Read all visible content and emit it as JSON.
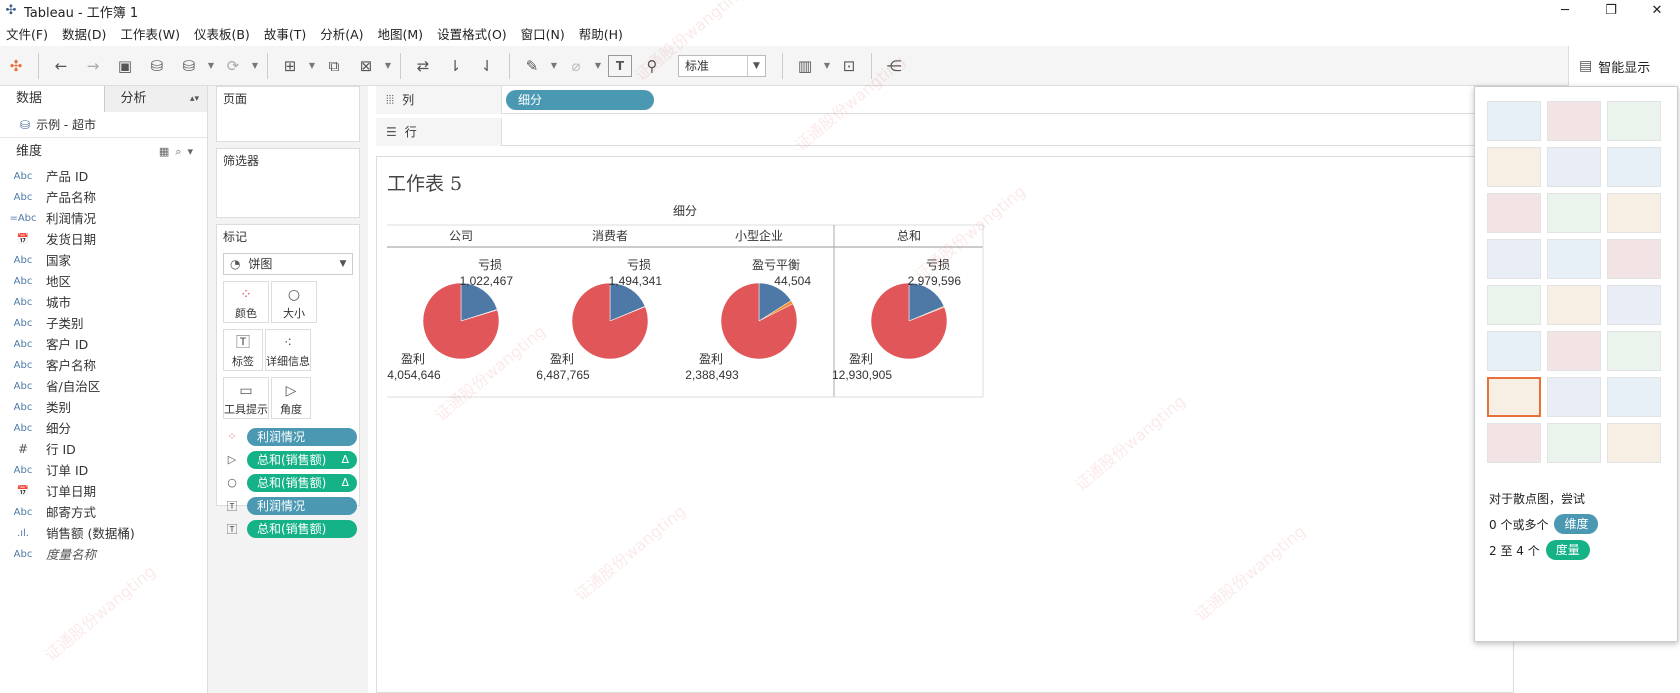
{
  "window": {
    "title": "Tableau - 工作簿 1",
    "minimize": "─",
    "maximize": "❐",
    "close": "✕"
  },
  "menu": [
    "文件(F)",
    "数据(D)",
    "工作表(W)",
    "仪表板(B)",
    "故事(T)",
    "分析(A)",
    "地图(M)",
    "设置格式(O)",
    "窗口(N)",
    "帮助(H)"
  ],
  "toolbar": {
    "fit_select": "标准",
    "smart_show_label": "智能显示"
  },
  "data_pane": {
    "tab_data": "数据",
    "tab_analysis": "分析",
    "source": "示例 - 超市",
    "dimensions_header": "维度",
    "fields": [
      {
        "type": "Abc",
        "name": "产品 ID"
      },
      {
        "type": "Abc",
        "name": "产品名称"
      },
      {
        "type": "=Abc",
        "name": "利润情况"
      },
      {
        "type": "📅",
        "name": "发货日期"
      },
      {
        "type": "Abc",
        "name": "国家"
      },
      {
        "type": "Abc",
        "name": "地区"
      },
      {
        "type": "Abc",
        "name": "城市"
      },
      {
        "type": "Abc",
        "name": "子类别"
      },
      {
        "type": "Abc",
        "name": "客户 ID"
      },
      {
        "type": "Abc",
        "name": "客户名称"
      },
      {
        "type": "Abc",
        "name": "省/自治区"
      },
      {
        "type": "Abc",
        "name": "类别"
      },
      {
        "type": "Abc",
        "name": "细分"
      },
      {
        "type": "#",
        "name": "行 ID"
      },
      {
        "type": "Abc",
        "name": "订单 ID"
      },
      {
        "type": "📅",
        "name": "订单日期"
      },
      {
        "type": "Abc",
        "name": "邮寄方式"
      },
      {
        "type": ".ıl.",
        "name": "销售额 (数据桶)"
      },
      {
        "type": "Abc",
        "name": "度量名称"
      }
    ]
  },
  "cards": {
    "pages": "页面",
    "filters": "筛选器",
    "marks": "标记",
    "mark_type": "饼图",
    "mark_buttons": [
      "颜色",
      "大小",
      "标签",
      "详细信息",
      "工具提示",
      "角度"
    ],
    "mark_pills": [
      {
        "label": "利润情况",
        "kind": "blue",
        "delta": ""
      },
      {
        "label": "总和(销售额)",
        "kind": "green",
        "delta": "Δ"
      },
      {
        "label": "总和(销售额)",
        "kind": "green",
        "delta": "Δ"
      },
      {
        "label": "利润情况",
        "kind": "blue",
        "delta": ""
      },
      {
        "label": "总和(销售额)",
        "kind": "green",
        "delta": ""
      }
    ]
  },
  "shelves": {
    "columns_label": "列",
    "rows_label": "行",
    "columns_pill": "细分"
  },
  "sheet": {
    "title": "工作表 5",
    "header": "细分"
  },
  "chart_data": {
    "type": "pie",
    "columns": [
      "公司",
      "消费者",
      "小型企业",
      "总和"
    ],
    "slices": [
      {
        "category": "公司",
        "亏损": 1022467,
        "盈亏平衡": 12000,
        "盈利": 4054646
      },
      {
        "category": "消费者",
        "亏损": 1494341,
        "盈亏平衡": 15000,
        "盈利": 6487765
      },
      {
        "category": "小型企业",
        "亏损": 462788,
        "盈亏平衡": 44504,
        "盈利": 2388493
      },
      {
        "category": "总和",
        "亏损": 2979596,
        "盈亏平衡": 71504,
        "盈利": 12930905
      }
    ],
    "labels": [
      {
        "top_name": "亏损",
        "top_value": "1,022,467",
        "bottom_name": "盈利",
        "bottom_value": "4,054,646"
      },
      {
        "top_name": "亏损",
        "top_value": "1,494,341",
        "bottom_name": "盈利",
        "bottom_value": "6,487,765"
      },
      {
        "top_name": "盈亏平衡",
        "top_value": "44,504",
        "bottom_name": "盈利",
        "bottom_value": "2,388,493"
      },
      {
        "top_name": "亏损",
        "top_value": "2,979,596",
        "bottom_name": "盈利",
        "bottom_value": "12,930,905"
      }
    ],
    "colors": {
      "亏损": "#4e79a7",
      "盈亏平衡": "#f28e2b",
      "盈利": "#e15759"
    }
  },
  "smart_panel": {
    "hint": "对于散点图，尝试",
    "dim_prefix": "0 个或多个",
    "dim_tag": "维度",
    "mea_prefix": "2 至 4 个",
    "mea_tag": "度量"
  },
  "watermark": "证通股份wangting"
}
